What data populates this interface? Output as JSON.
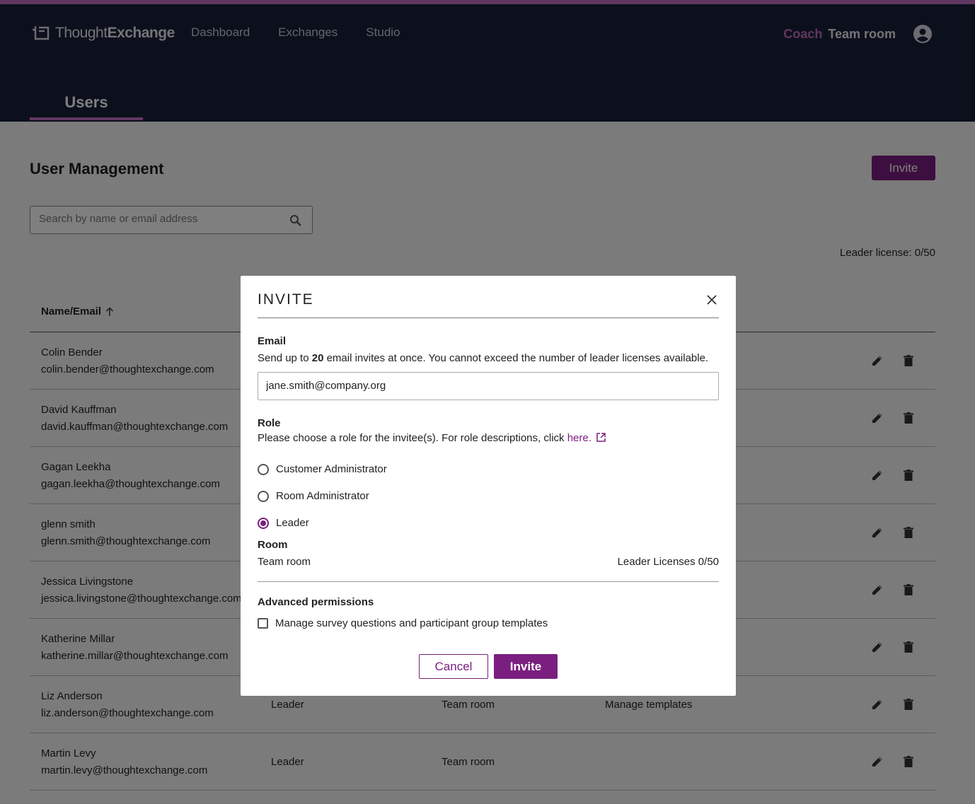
{
  "header": {
    "brand_light": "Thought",
    "brand_bold": "Exchange",
    "nav": [
      "Dashboard",
      "Exchanges",
      "Studio"
    ],
    "coach": "Coach",
    "room": "Team room",
    "tab": "Users"
  },
  "page": {
    "title": "User Management",
    "invite_label": "Invite",
    "search_placeholder": "Search by name or email address",
    "license_text": "Leader license: 0/50",
    "column_name": "Name/Email"
  },
  "users": [
    {
      "name": "Colin Bender",
      "email": "colin.bender@thoughtexchange.com",
      "role": "",
      "room": "",
      "perm": ""
    },
    {
      "name": "David Kauffman",
      "email": "david.kauffman@thoughtexchange.com",
      "role": "",
      "room": "",
      "perm": ""
    },
    {
      "name": "Gagan Leekha",
      "email": "gagan.leekha@thoughtexchange.com",
      "role": "",
      "room": "",
      "perm": ""
    },
    {
      "name": "glenn smith",
      "email": "glenn.smith@thoughtexchange.com",
      "role": "",
      "room": "",
      "perm": ""
    },
    {
      "name": "Jessica Livingstone",
      "email": "jessica.livingstone@thoughtexchange.com",
      "role": "",
      "room": "",
      "perm": ""
    },
    {
      "name": "Katherine Millar",
      "email": "katherine.millar@thoughtexchange.com",
      "role": "",
      "room": "",
      "perm": ""
    },
    {
      "name": "Liz Anderson",
      "email": "liz.anderson@thoughtexchange.com",
      "role": "Leader",
      "room": "Team room",
      "perm": "Manage templates"
    },
    {
      "name": "Martin Levy",
      "email": "martin.levy@thoughtexchange.com",
      "role": "Leader",
      "room": "Team room",
      "perm": ""
    }
  ],
  "modal": {
    "title": "INVITE",
    "email_label": "Email",
    "email_help_pre": "Send up to ",
    "email_help_count": "20",
    "email_help_post": " email invites at once. You cannot exceed the number of leader licenses available.",
    "email_value": "jane.smith@company.org",
    "role_label": "Role",
    "role_help": "Please choose a role for the invitee(s). For role descriptions, click ",
    "role_link": "here.",
    "roles": [
      "Customer Administrator",
      "Room Administrator",
      "Leader"
    ],
    "selected_role": "Leader",
    "room_label": "Room",
    "room_value": "Team room",
    "room_licenses": "Leader Licenses 0/50",
    "adv_label": "Advanced permissions",
    "adv_option": "Manage survey questions and participant group templates",
    "adv_checked": false,
    "cancel": "Cancel",
    "invite": "Invite"
  },
  "colors": {
    "accent": "#7a1f80",
    "nav_bg": "#19203a",
    "accent_light": "#c06ec2"
  }
}
